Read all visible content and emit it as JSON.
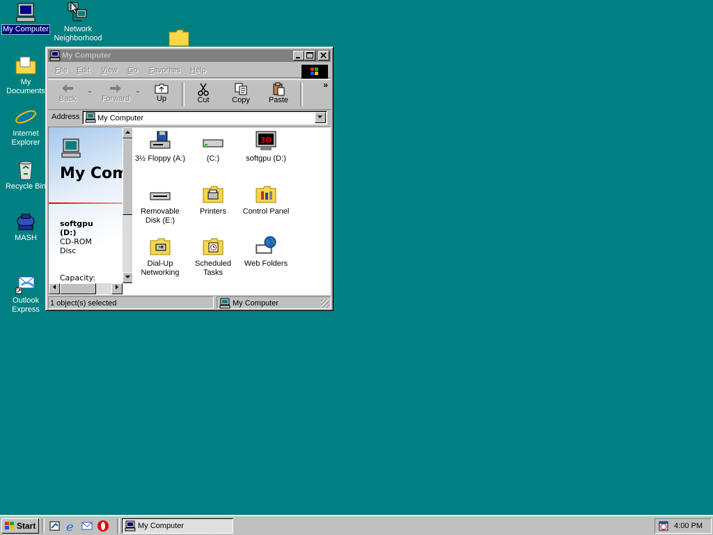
{
  "desktop": {
    "icons": [
      {
        "label": "My Computer",
        "icon": "my-computer-icon",
        "selected": true
      },
      {
        "label": "Network Neighborhood",
        "icon": "network-icon"
      },
      {
        "label": "My Documents",
        "icon": "folder-icon"
      },
      {
        "label": "Internet Explorer",
        "icon": "ie-icon"
      },
      {
        "label": "Recycle Bin",
        "icon": "recycle-bin-icon"
      },
      {
        "label": "MASH",
        "icon": "mash-icon"
      },
      {
        "label": "Outlook Express",
        "icon": "outlook-express-icon"
      }
    ]
  },
  "window": {
    "title": "My Computer",
    "menu": [
      "File",
      "Edit",
      "View",
      "Go",
      "Favorites",
      "Help"
    ],
    "toolbar": {
      "back": "Back",
      "forward": "Forward",
      "up": "Up",
      "cut": "Cut",
      "copy": "Copy",
      "paste": "Paste",
      "chevron": "»"
    },
    "address": {
      "label": "Address",
      "value": "My Computer"
    },
    "left_pane": {
      "title": "My Computer",
      "selected_name": "softgpu (D:)",
      "selected_type": "CD-ROM Disc",
      "capacity_label": "Capacity:"
    },
    "items": [
      {
        "label": "3½ Floppy (A:)",
        "icon": "floppy-drive-icon"
      },
      {
        "label": "(C:)",
        "icon": "hard-drive-icon"
      },
      {
        "label": "softgpu (D:)",
        "icon": "cdrom-3d-icon",
        "badge": "3D"
      },
      {
        "label": "Removable Disk (E:)",
        "icon": "removable-disk-icon"
      },
      {
        "label": "Printers",
        "icon": "printers-folder-icon"
      },
      {
        "label": "Control Panel",
        "icon": "control-panel-icon"
      },
      {
        "label": "Dial-Up Networking",
        "icon": "dialup-networking-icon"
      },
      {
        "label": "Scheduled Tasks",
        "icon": "scheduled-tasks-icon"
      },
      {
        "label": "Web Folders",
        "icon": "web-folders-icon"
      }
    ],
    "status": {
      "left": "1 object(s) selected",
      "right": "My Computer"
    }
  },
  "taskbar": {
    "start_label": "Start",
    "task_label": "My Computer",
    "clock": "4:00 PM"
  },
  "colors": {
    "desktop": "#008080",
    "title_inactive": "#808080",
    "selection": "#000080",
    "face": "#c0c0c0"
  }
}
